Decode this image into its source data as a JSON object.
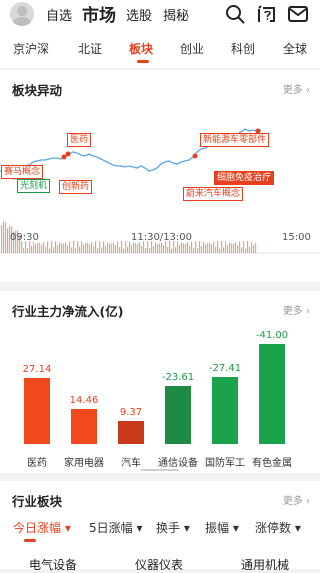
{
  "top_nav": {
    "items": [
      "自选",
      "市场",
      "选股",
      "揭秘"
    ],
    "icons": [
      "search-icon",
      "qa-icon",
      "mail-icon"
    ]
  },
  "market_tabs": [
    "京沪深",
    "北证",
    "板块",
    "创业",
    "科创",
    "全球"
  ],
  "anomaly_card": {
    "title": "板块异动",
    "more": "更多",
    "annotations": [
      "赛马概念",
      "光刻机",
      "医药",
      "创新药",
      "新能源车零部件",
      "细胞免疫治疗",
      "蔚来汽车概念"
    ],
    "x_ticks": [
      "09:30",
      "11:30/13:00",
      "15:00"
    ]
  },
  "chart_data": {
    "type": "bar",
    "title": "行业主力净流入(亿)",
    "categories": [
      "医药",
      "家用电器",
      "汽车",
      "通信设备",
      "国防军工",
      "有色金属"
    ],
    "values": [
      27.14,
      14.46,
      9.37,
      -23.61,
      -27.41,
      -41.0
    ],
    "value_labels": [
      "27.14",
      "14.46",
      "9.37",
      "-23.61",
      "-27.41",
      "-41.00"
    ],
    "colors": {
      "positive": "#f04a1c",
      "negative": "#1aa34a"
    }
  },
  "flow_card": {
    "more": "更多"
  },
  "sector_card": {
    "title": "行业板块",
    "more": "更多",
    "sort_tabs": [
      "今日涨幅",
      "5日涨幅",
      "换手",
      "振幅",
      "涨停数"
    ],
    "columns": [
      "电气设备",
      "仪器仪表",
      "通用机械"
    ]
  },
  "colors": {
    "accent": "#e8401c",
    "up": "#e8401c",
    "down": "#1a9a48"
  }
}
